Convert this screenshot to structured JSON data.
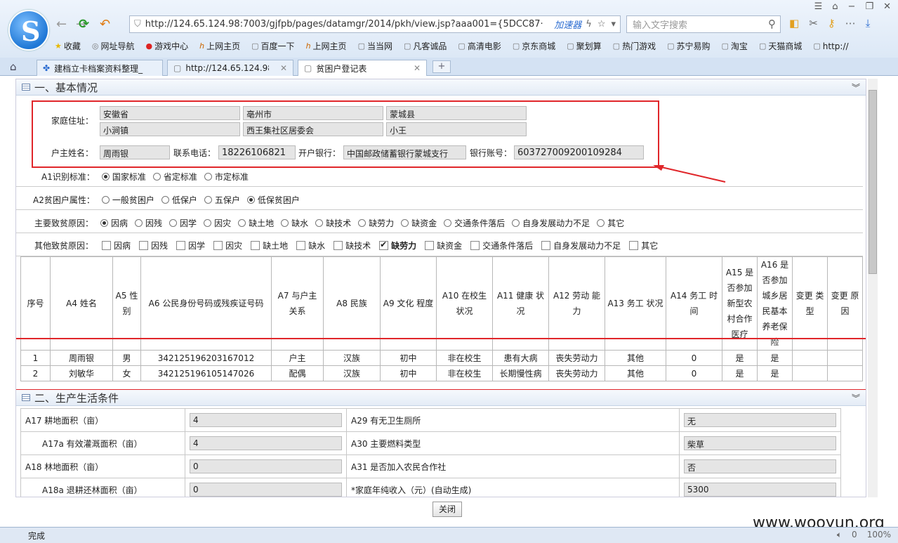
{
  "browser": {
    "url": "http://124.65.124.98:7003/gjfpb/pages/datamgr/2014/pkh/view.jsp?aaa001={5DCC87·",
    "accel_label": "加速器",
    "search_placeholder": "输入文字搜索"
  },
  "bookmarks": [
    "收藏",
    "网址导航",
    "游戏中心",
    "上网主页",
    "百度一下",
    "上网主页",
    "当当网",
    "凡客诚品",
    "高清电影",
    "京东商城",
    "聚划算",
    "热门游戏",
    "苏宁易购",
    "淘宝",
    "天猫商城",
    "http://"
  ],
  "tabs": [
    {
      "label": "建档立卡档案资料整理_"
    },
    {
      "label": "http://124.65.124.98:7"
    },
    {
      "label": "贫困户登记表"
    }
  ],
  "section1": {
    "title": "一、基本情况",
    "address_label": "家庭住址：",
    "addr": [
      "安徽省",
      "亳州市",
      "蒙城县",
      "小涧镇",
      "西王集社区居委会",
      "小王"
    ],
    "head_label": "户主姓名：",
    "head_name": "周雨银",
    "phone_label": "联系电话：",
    "phone": "18226106821",
    "bank_label": "开户银行：",
    "bank": "中国邮政储蓄银行蒙城支行",
    "account_label": "银行账号：",
    "account": "603727009200109284",
    "a1_label": "A1识别标准：",
    "a1_opts": [
      "国家标准",
      "省定标准",
      "市定标准"
    ],
    "a2_label": "A2贫困户属性：",
    "a2_opts": [
      "一般贫困户",
      "低保户",
      "五保户",
      "低保贫困户"
    ],
    "main_label": "主要致贫原因：",
    "main_opts": [
      "因病",
      "因残",
      "因学",
      "因灾",
      "缺土地",
      "缺水",
      "缺技术",
      "缺劳力",
      "缺资金",
      "交通条件落后",
      "自身发展动力不足",
      "其它"
    ],
    "other_label": "其他致贫原因：",
    "other_opts": [
      "因病",
      "因残",
      "因学",
      "因灾",
      "缺土地",
      "缺水",
      "缺技术",
      "缺劳力",
      "缺资金",
      "交通条件落后",
      "自身发展动力不足",
      "其它"
    ]
  },
  "table": {
    "headers": [
      "序号",
      "A4 姓名",
      "A5 性别",
      "A6 公民身份号码或残疾证号码",
      "A7 与户主 关系",
      "A8 民族",
      "A9 文化 程度",
      "A10 在校生 状况",
      "A11 健康 状况",
      "A12 劳动 能力",
      "A13 务工 状况",
      "A14 务工 时间",
      "A15 是否参加新型农村合作医疗",
      "A16 是否参加城乡居民基本养老保险",
      "变更 类型",
      "变更 原因"
    ],
    "rows": [
      [
        "1",
        "周雨银",
        "男",
        "342125196203167012",
        "户主",
        "汉族",
        "初中",
        "非在校生",
        "患有大病",
        "丧失劳动力",
        "其他",
        "0",
        "是",
        "是",
        "",
        ""
      ],
      [
        "2",
        "刘敏华",
        "女",
        "342125196105147026",
        "配偶",
        "汉族",
        "初中",
        "非在校生",
        "长期慢性病",
        "丧失劳动力",
        "其他",
        "0",
        "是",
        "是",
        "",
        ""
      ]
    ]
  },
  "section2": {
    "title": "二、生产生活条件",
    "rows": [
      {
        "l1": "A17 耕地面积（亩）",
        "v1": "4",
        "l2": "A29 有无卫生厕所",
        "v2": "无"
      },
      {
        "l1": "A17a 有效灌溉面积（亩）",
        "v1": "4",
        "l2": "A30 主要燃料类型",
        "v2": "柴草"
      },
      {
        "l1": "A18 林地面积（亩）",
        "v1": "0",
        "l2": "A31 是否加入农民合作社",
        "v2": "否"
      },
      {
        "l1": "A18a 退耕还林面积（亩）",
        "v1": "0",
        "l2": "*家庭年纯收入（元）(自动生成)",
        "v2": "5300"
      }
    ]
  },
  "close_label": "关闭",
  "watermark": "www.wooyun.org",
  "status": {
    "text": "完成",
    "zoom": "100%",
    "count": "0"
  }
}
